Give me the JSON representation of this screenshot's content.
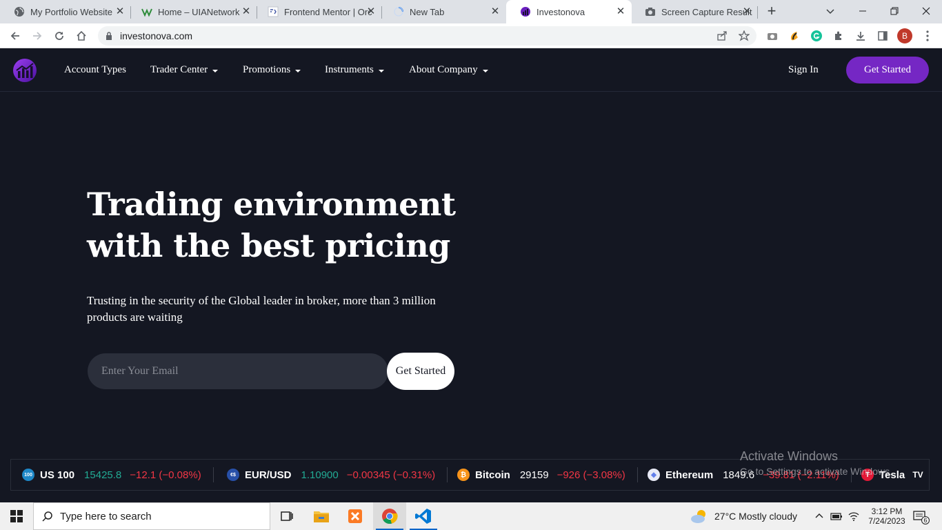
{
  "browser": {
    "tabs": [
      {
        "title": "My Portfolio Website",
        "favicon": "globe-icon"
      },
      {
        "title": "Home – UIANetwork",
        "favicon": "uia-icon"
      },
      {
        "title": "Frontend Mentor | Orc",
        "favicon": "frontend-mentor-icon"
      },
      {
        "title": "New Tab",
        "favicon": "loading-icon"
      },
      {
        "title": "Investonova",
        "favicon": "investonova-icon",
        "active": true
      },
      {
        "title": "Screen Capture Result",
        "favicon": "camera-icon"
      }
    ],
    "url": "investonova.com",
    "profile_initial": "B"
  },
  "site": {
    "nav": {
      "links": [
        {
          "label": "Account Types",
          "dropdown": false
        },
        {
          "label": "Trader Center",
          "dropdown": true
        },
        {
          "label": "Promotions",
          "dropdown": true
        },
        {
          "label": "Instruments",
          "dropdown": true
        },
        {
          "label": "About Company",
          "dropdown": true
        }
      ],
      "sign_in": "Sign In",
      "cta": "Get Started"
    },
    "hero": {
      "title_line1": "Trading environment",
      "title_line2": "with the best pricing",
      "subtitle": "Trusting in the security of the Global leader in broker, more than 3 million products are waiting",
      "email_placeholder": "Enter Your Email",
      "button": "Get Started"
    },
    "ticker": [
      {
        "name": "US 100",
        "price": "15425.8",
        "change": "−12.1 (−0.08%)",
        "icon": "us100-icon",
        "price_color": "#22ab94"
      },
      {
        "name": "EUR/USD",
        "price": "1.10900",
        "change": "−0.00345 (−0.31%)",
        "icon": "eurusd-icon",
        "price_color": "#22ab94"
      },
      {
        "name": "Bitcoin",
        "price": "29159",
        "change": "−926 (−3.08%)",
        "icon": "bitcoin-icon",
        "price_color": "#ffffff"
      },
      {
        "name": "Ethereum",
        "price": "1849.6",
        "change": "−39.81 (−2.11%)",
        "icon": "ethereum-icon",
        "price_color": "#ffffff"
      },
      {
        "name": "Tesla",
        "price": "",
        "change": "",
        "icon": "tesla-icon",
        "price_color": "#ffffff"
      }
    ]
  },
  "watermark": {
    "line1": "Activate Windows",
    "line2": "Go to Settings to activate Windows."
  },
  "taskbar": {
    "search_placeholder": "Type here to search",
    "weather": "27°C  Mostly cloudy",
    "time": "3:12 PM",
    "date": "7/24/2023",
    "notifications": "6"
  },
  "colors": {
    "accent": "#7527c4",
    "background": "#141722",
    "negative": "#f23645",
    "positive": "#22ab94"
  }
}
